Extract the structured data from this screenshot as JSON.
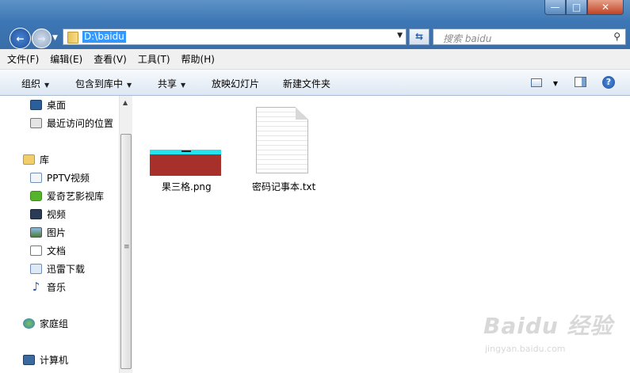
{
  "window": {
    "controls": {
      "minimize": "—",
      "maximize": "□",
      "close": "✕"
    }
  },
  "address_bar": {
    "path": "D:\\baidu"
  },
  "search": {
    "placeholder": "搜索 baidu"
  },
  "menu": [
    {
      "label": "文件(F)"
    },
    {
      "label": "编辑(E)"
    },
    {
      "label": "查看(V)"
    },
    {
      "label": "工具(T)"
    },
    {
      "label": "帮助(H)"
    }
  ],
  "command_bar": {
    "organize": "组织",
    "include_in_library": "包含到库中",
    "share": "共享",
    "slideshow": "放映幻灯片",
    "new_folder": "新建文件夹"
  },
  "nav_pane": {
    "favorites": [
      {
        "label": "桌面",
        "icon": "desktop-icon"
      },
      {
        "label": "最近访问的位置",
        "icon": "recent-places-icon"
      }
    ],
    "libraries_header": {
      "label": "库",
      "icon": "library-icon"
    },
    "libraries": [
      {
        "label": "PPTV视频",
        "icon": "video-library-icon"
      },
      {
        "label": "爱奇艺影视库",
        "icon": "iqiyi-icon"
      },
      {
        "label": "视频",
        "icon": "video-icon"
      },
      {
        "label": "图片",
        "icon": "pictures-icon"
      },
      {
        "label": "文档",
        "icon": "documents-icon"
      },
      {
        "label": "迅雷下载",
        "icon": "download-icon"
      },
      {
        "label": "音乐",
        "icon": "music-icon"
      }
    ],
    "homegroup": {
      "label": "家庭组",
      "icon": "homegroup-icon"
    },
    "computer": {
      "label": "计算机",
      "icon": "computer-icon"
    }
  },
  "files": [
    {
      "name": "果三格.png",
      "type": "image"
    },
    {
      "name": "密码记事本.txt",
      "type": "text"
    }
  ],
  "watermark": {
    "brand": "Baidu 经验",
    "url": "jingyan.baidu.com"
  }
}
